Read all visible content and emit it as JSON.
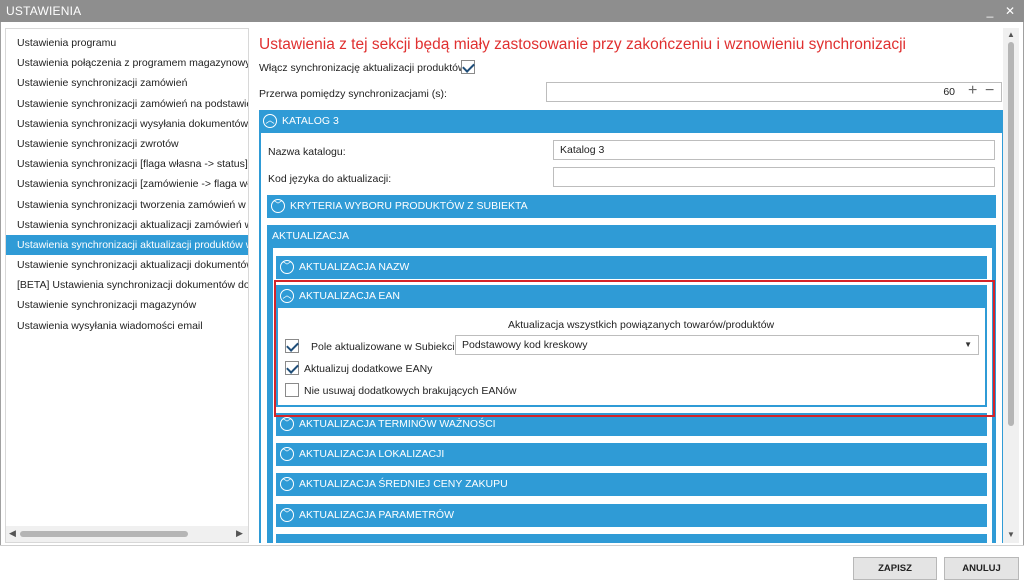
{
  "window": {
    "title": "USTAWIENIA",
    "minimize_glyph": "_",
    "close_glyph": "✕"
  },
  "sidebar": {
    "items": [
      {
        "label": "Ustawienia programu"
      },
      {
        "label": "Ustawienia połączenia z programem magazynowym"
      },
      {
        "label": "Ustawienie synchronizacji zamówień"
      },
      {
        "label": "Ustawienie synchronizacji zamówień na podstawie dzi"
      },
      {
        "label": "Ustawienia synchronizacji wysyłania dokumentów"
      },
      {
        "label": "Ustawienie synchronizacji zwrotów"
      },
      {
        "label": "Ustawienia synchronizacji [flaga własna -> status]"
      },
      {
        "label": "Ustawienia synchronizacji [zamówienie -> flaga własn"
      },
      {
        "label": "Ustawienia synchronizacji tworzenia zamówień w Bas"
      },
      {
        "label": "Ustawienia synchronizacji aktualizacji zamówień w Ba"
      },
      {
        "label": "Ustawienia synchronizacji aktualizacji produktów w Ba"
      },
      {
        "label": "Ustawienie synchronizacji aktualizacji dokumentów"
      },
      {
        "label": "[BETA] Ustawienia synchronizacji dokumentów dostaw"
      },
      {
        "label": "Ustawienie synchronizacji magazynów"
      },
      {
        "label": "Ustawienia wysyłania wiadomości email"
      }
    ],
    "active_index": 10
  },
  "main": {
    "heading": "Ustawienia z tej sekcji będą miały zastosowanie przy zakończeniu i wznowieniu synchronizacji",
    "enable_sync": {
      "label": "Włącz synchronizację aktualizacji produktów:",
      "checked": true
    },
    "interval": {
      "label": "Przerwa pomiędzy synchronizacjami (s):",
      "value": "60",
      "plus": "+",
      "minus": "−"
    },
    "catalog": {
      "header": "KATALOG 3",
      "name_label": "Nazwa katalogu:",
      "name_value": "Katalog 3",
      "lang_label": "Kod języka do aktualizacji:",
      "lang_value": "",
      "criteria_header": "KRYTERIA WYBORU PRODUKTÓW Z SUBIEKTA",
      "update_header": "AKTUALIZACJA",
      "sections": [
        {
          "label": "AKTUALIZACJA NAZW",
          "expanded": false
        },
        {
          "label": "AKTUALIZACJA EAN",
          "expanded": true
        },
        {
          "label": "AKTUALIZACJA TERMINÓW WAŻNOŚCI",
          "expanded": false
        },
        {
          "label": "AKTUALIZACJA LOKALIZACJI",
          "expanded": false
        },
        {
          "label": "AKTUALIZACJA ŚREDNIEJ CENY ZAKUPU",
          "expanded": false
        },
        {
          "label": "AKTUALIZACJA PARAMETRÓW",
          "expanded": false
        }
      ],
      "ean": {
        "description": "Aktualizacja wszystkich powiązanych towarów/produktów",
        "field_label": "Pole aktualizowane w Subiekcie:",
        "field_checked": true,
        "field_value": "Podstawowy kod kreskowy",
        "extra_label": "Aktualizuj dodatkowe EANy",
        "extra_checked": true,
        "nodelete_label": "Nie usuwaj dodatkowych brakujących EANów",
        "nodelete_checked": false
      }
    }
  },
  "footer": {
    "save_label": "ZAPISZ",
    "cancel_label": "ANULUJ"
  },
  "colors": {
    "accent": "#2f9bd6",
    "heading": "#e03030",
    "highlight_box": "#d4242a"
  },
  "icons": {
    "expand": "chevron-up-circle-icon",
    "collapse": "chevron-down-circle-icon"
  }
}
